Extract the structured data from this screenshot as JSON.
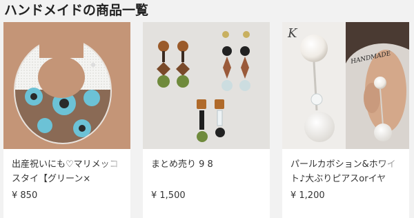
{
  "section": {
    "title": "ハンドメイドの商品一覧"
  },
  "items": [
    {
      "name": "出産祝いにも♡マリメッコ スタイ【グリーン×",
      "price": "¥ 850",
      "image": "bib-photo"
    },
    {
      "name": "まとめ売り 9 8",
      "price": "¥ 1,500",
      "image": "earrings-photo"
    },
    {
      "name": "パールカボション&ホワイト♪大ぶりピアスorイヤ",
      "price": "¥ 1,200",
      "image": "pearl-earrings-photo",
      "image_text": [
        "K",
        "HANDMADE"
      ]
    }
  ]
}
